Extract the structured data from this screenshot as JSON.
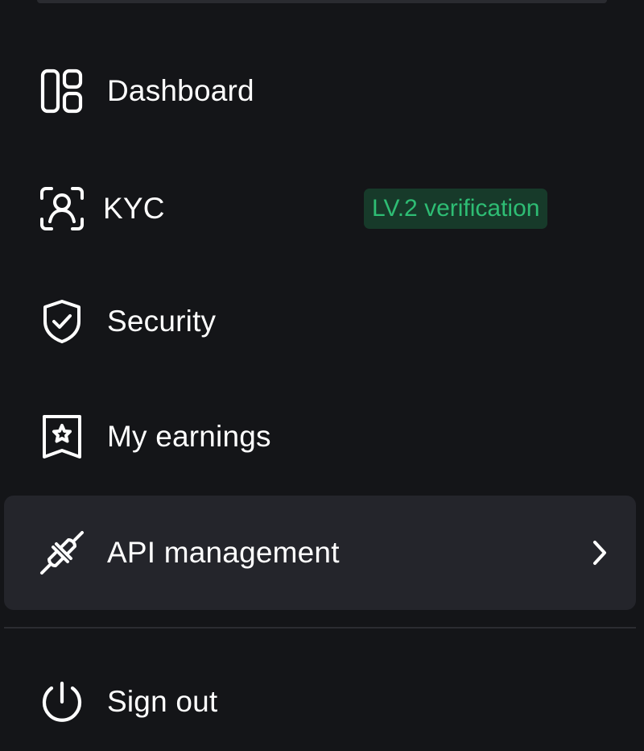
{
  "menu": {
    "items": [
      {
        "label": "Dashboard",
        "icon": "dashboard-icon"
      },
      {
        "label": "KYC",
        "icon": "user-scan-icon",
        "badge": "LV.2 verification"
      },
      {
        "label": "Security",
        "icon": "shield-check-icon"
      },
      {
        "label": "My earnings",
        "icon": "star-bookmark-icon"
      },
      {
        "label": "API management",
        "icon": "plug-icon",
        "active": true,
        "trailing_icon": "chevron-right-icon"
      }
    ],
    "sign_out": {
      "label": "Sign out",
      "icon": "power-icon"
    }
  },
  "colors": {
    "background": "#141518",
    "active_row": "#24252b",
    "badge_bg": "#173a2a",
    "badge_text": "#2ebd74",
    "text": "#ffffff"
  }
}
